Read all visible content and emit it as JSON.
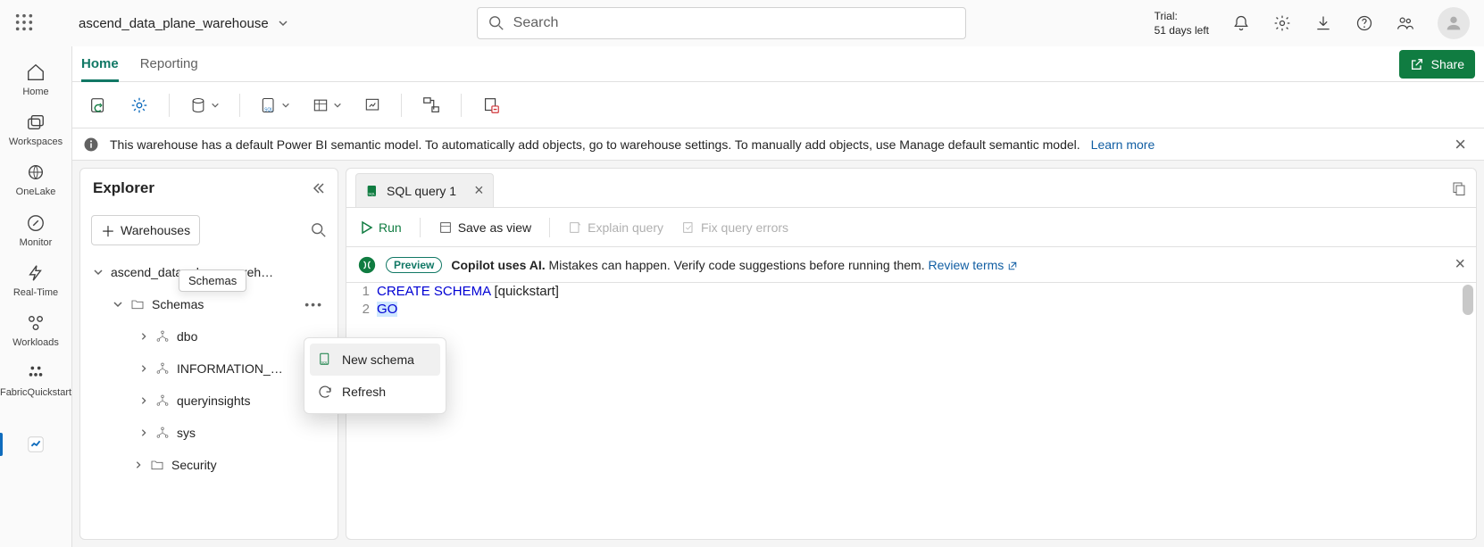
{
  "header": {
    "title": "ascend_data_plane_warehouse",
    "search_placeholder": "Search",
    "trial_line1": "Trial:",
    "trial_line2": "51 days left",
    "share_label": "Share"
  },
  "tabs": {
    "home": "Home",
    "reporting": "Reporting"
  },
  "banner": {
    "text": "This warehouse has a default Power BI semantic model. To automatically add objects, go to warehouse settings. To manually add objects, use Manage default semantic model.",
    "link": "Learn more"
  },
  "rail": {
    "home": "Home",
    "workspaces": "Workspaces",
    "onelake": "OneLake",
    "monitor": "Monitor",
    "realtime": "Real-Time",
    "workloads": "Workloads",
    "fabricqs": "FabricQuickstart"
  },
  "explorer": {
    "title": "Explorer",
    "add_wh": "Warehouses",
    "root": "ascend_data_plane_wareh…",
    "schemas": "Schemas",
    "tooltip": "Schemas",
    "nodes": {
      "dbo": "dbo",
      "info": "INFORMATION_…",
      "qi": "queryinsights",
      "sys": "sys",
      "security": "Security"
    }
  },
  "ctx": {
    "new_schema": "New schema",
    "refresh": "Refresh"
  },
  "editor": {
    "tab_name": "SQL query 1",
    "actions": {
      "run": "Run",
      "save": "Save as view",
      "explain": "Explain query",
      "fix": "Fix query errors"
    },
    "copilot": {
      "preview": "Preview",
      "bold": "Copilot uses AI.",
      "rest": " Mistakes can happen. Verify code suggestions before running them. ",
      "link": "Review terms"
    },
    "code": {
      "l1_kw1": "CREATE",
      "l1_kw2": "SCHEMA",
      "l1_id": "[quickstart]",
      "l2": "GO",
      "line1_num": "1",
      "line2_num": "2"
    }
  }
}
